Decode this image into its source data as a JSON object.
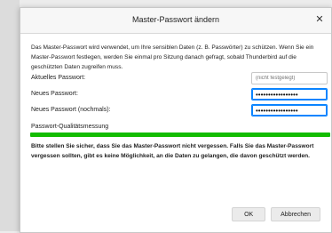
{
  "dialog": {
    "title": "Master-Passwort ändern",
    "intro": "Das Master-Passwort wird verwendet, um Ihre sensiblen Daten (z. B. Passwörter) zu schützen. Wenn Sie ein Master-Passwort festlegen, werden Sie einmal pro Sitzung danach gefragt, sobald Thunderbird auf die geschützten Daten zugreifen muss.",
    "current_password_label": "Aktuelles Passwort:",
    "current_password_placeholder": "(nicht festgelegt)",
    "new_password_label": "Neues Passwort:",
    "new_password_value": "•••••••••••••••••",
    "new_password_confirm_label": "Neues Passwort (nochmals):",
    "new_password_confirm_value": "•••••••••••••••••",
    "quality_label": "Passwort-Qualitätsmessung",
    "quality_percent": 100,
    "warning": "Bitte stellen Sie sicher, dass Sie das Master-Passwort nicht vergessen. Falls Sie das Master-Passwort vergessen sollten, gibt es keine Möglichkeit, an die Daten zu gelangen, die davon geschützt werden.",
    "ok_label": "OK",
    "cancel_label": "Abbrechen"
  },
  "colors": {
    "meter_fill": "#12bc00",
    "focus_border": "#0a84ff"
  },
  "icons": {
    "close": "close-icon"
  }
}
